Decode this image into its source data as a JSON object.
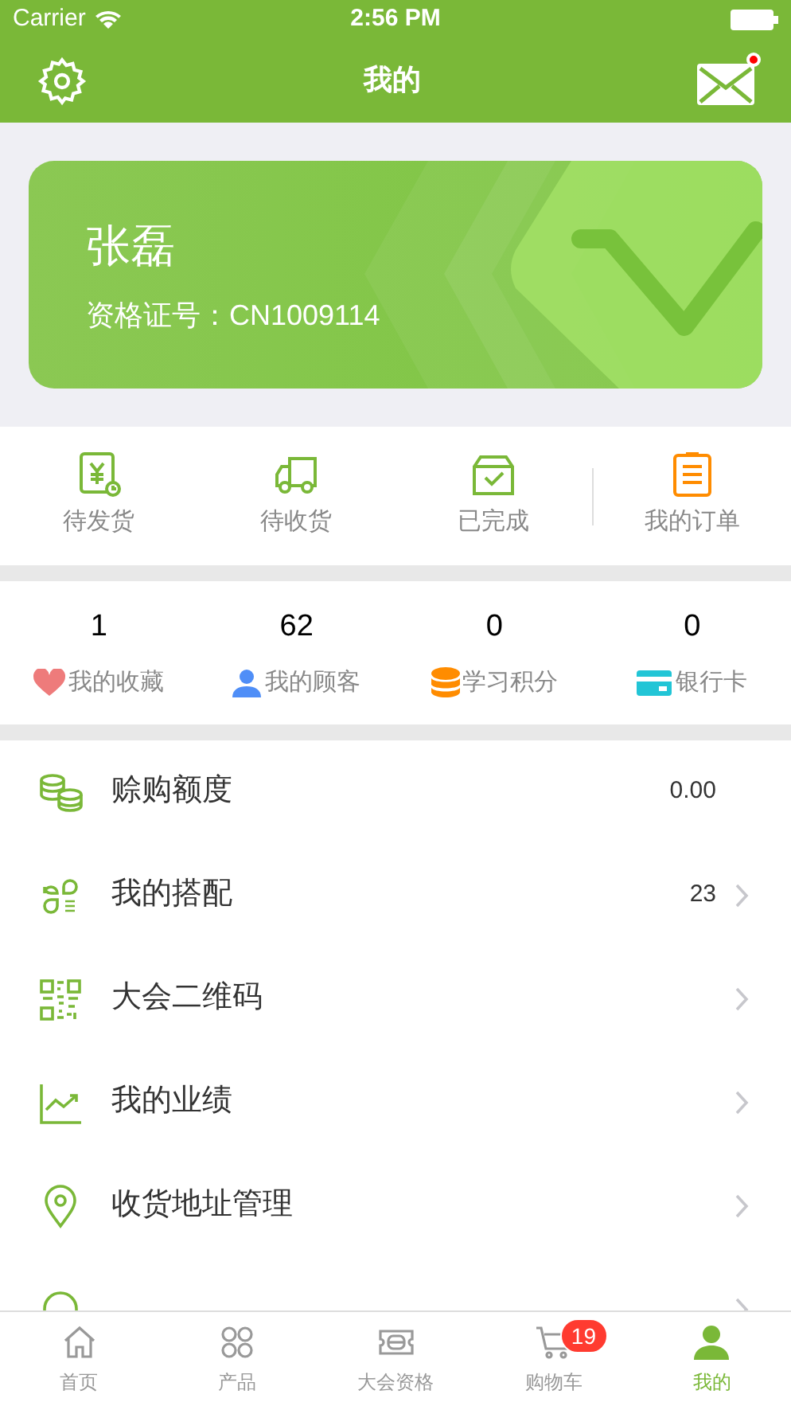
{
  "status_bar": {
    "carrier": "Carrier",
    "time": "2:56 PM"
  },
  "nav": {
    "title": "我的",
    "has_unread_mail": true
  },
  "member_card": {
    "name": "张磊",
    "certificate": "资格证号：CN1009114"
  },
  "orders": [
    {
      "kind": "pending-ship",
      "label": "待发货"
    },
    {
      "kind": "pending-receive",
      "label": "待收货"
    },
    {
      "kind": "completed",
      "label": "已完成"
    },
    {
      "kind": "all-orders",
      "label": "我的订单"
    }
  ],
  "stats": [
    {
      "kind": "favorites",
      "value": "1",
      "label": "我的收藏"
    },
    {
      "kind": "customers",
      "value": "62",
      "label": "我的顾客"
    },
    {
      "kind": "points",
      "value": "0",
      "label": "学习积分"
    },
    {
      "kind": "bank-card",
      "value": "0",
      "label": "银行卡"
    }
  ],
  "menu": [
    {
      "kind": "coins",
      "label": "赊购额度",
      "value": "0.00",
      "chevron": false
    },
    {
      "kind": "match",
      "label": "我的搭配",
      "value": "23",
      "chevron": true
    },
    {
      "kind": "qr",
      "label": "大会二维码",
      "chevron": true
    },
    {
      "kind": "chart",
      "label": "我的业绩",
      "chevron": true
    },
    {
      "kind": "pin",
      "label": "收货地址管理",
      "chevron": true
    },
    {
      "kind": "headset",
      "chevron": true
    }
  ],
  "tab_bar": [
    {
      "kind": "home",
      "label": "首页",
      "selected": false
    },
    {
      "kind": "products",
      "label": "产品",
      "selected": false
    },
    {
      "kind": "ticket",
      "label": "大会资格",
      "selected": false
    },
    {
      "kind": "cart",
      "label": "购物车",
      "badge": "19",
      "selected": false
    },
    {
      "kind": "me",
      "label": "我的",
      "selected": true
    }
  ]
}
